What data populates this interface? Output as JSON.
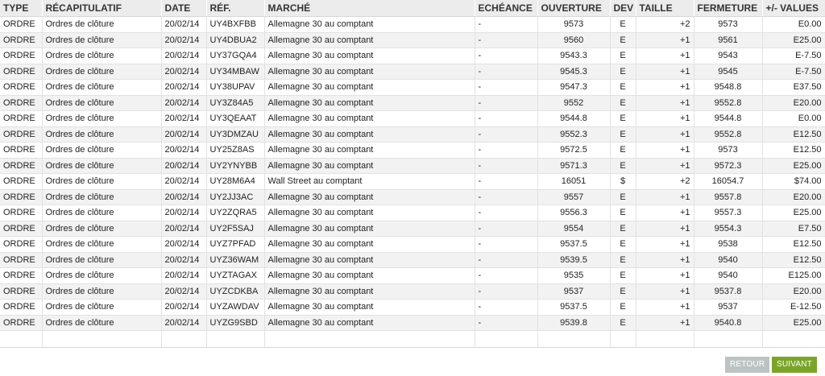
{
  "columns": {
    "type": "TYPE",
    "recap": "RÉCAPITULATIF",
    "date": "DATE",
    "ref": "RÉF.",
    "marche": "MARCHÉ",
    "echeance": "ECHÉANCE",
    "ouverture": "OUVERTURE",
    "dev": "DEV",
    "taille": "TAILLE",
    "fermeture": "FERMETURE",
    "values": "+/- VALUES"
  },
  "rows": [
    {
      "type": "ORDRE",
      "recap": "Ordres de clôture",
      "date": "20/02/14",
      "ref": "UY4BXFBB",
      "marche": "Allemagne 30 au comptant",
      "echeance": "-",
      "ouverture": "9573",
      "dev": "E",
      "taille": "+2",
      "fermeture": "9573",
      "values": "E0.00"
    },
    {
      "type": "ORDRE",
      "recap": "Ordres de clôture",
      "date": "20/02/14",
      "ref": "UY4DBUA2",
      "marche": "Allemagne 30 au comptant",
      "echeance": "-",
      "ouverture": "9560",
      "dev": "E",
      "taille": "+1",
      "fermeture": "9561",
      "values": "E25.00"
    },
    {
      "type": "ORDRE",
      "recap": "Ordres de clôture",
      "date": "20/02/14",
      "ref": "UY37GQA4",
      "marche": "Allemagne 30 au comptant",
      "echeance": "-",
      "ouverture": "9543.3",
      "dev": "E",
      "taille": "+1",
      "fermeture": "9543",
      "values": "E-7.50"
    },
    {
      "type": "ORDRE",
      "recap": "Ordres de clôture",
      "date": "20/02/14",
      "ref": "UY34MBAW",
      "marche": "Allemagne 30 au comptant",
      "echeance": "-",
      "ouverture": "9545.3",
      "dev": "E",
      "taille": "+1",
      "fermeture": "9545",
      "values": "E-7.50"
    },
    {
      "type": "ORDRE",
      "recap": "Ordres de clôture",
      "date": "20/02/14",
      "ref": "UY38UPAV",
      "marche": "Allemagne 30 au comptant",
      "echeance": "-",
      "ouverture": "9547.3",
      "dev": "E",
      "taille": "+1",
      "fermeture": "9548.8",
      "values": "E37.50"
    },
    {
      "type": "ORDRE",
      "recap": "Ordres de clôture",
      "date": "20/02/14",
      "ref": "UY3Z84A5",
      "marche": "Allemagne 30 au comptant",
      "echeance": "-",
      "ouverture": "9552",
      "dev": "E",
      "taille": "+1",
      "fermeture": "9552.8",
      "values": "E20.00"
    },
    {
      "type": "ORDRE",
      "recap": "Ordres de clôture",
      "date": "20/02/14",
      "ref": "UY3QEAAT",
      "marche": "Allemagne 30 au comptant",
      "echeance": "-",
      "ouverture": "9544.8",
      "dev": "E",
      "taille": "+1",
      "fermeture": "9544.8",
      "values": "E0.00"
    },
    {
      "type": "ORDRE",
      "recap": "Ordres de clôture",
      "date": "20/02/14",
      "ref": "UY3DMZAU",
      "marche": "Allemagne 30 au comptant",
      "echeance": "-",
      "ouverture": "9552.3",
      "dev": "E",
      "taille": "+1",
      "fermeture": "9552.8",
      "values": "E12.50"
    },
    {
      "type": "ORDRE",
      "recap": "Ordres de clôture",
      "date": "20/02/14",
      "ref": "UY25Z8AS",
      "marche": "Allemagne 30 au comptant",
      "echeance": "-",
      "ouverture": "9572.5",
      "dev": "E",
      "taille": "+1",
      "fermeture": "9573",
      "values": "E12.50"
    },
    {
      "type": "ORDRE",
      "recap": "Ordres de clôture",
      "date": "20/02/14",
      "ref": "UY2YNYBB",
      "marche": "Allemagne 30 au comptant",
      "echeance": "-",
      "ouverture": "9571.3",
      "dev": "E",
      "taille": "+1",
      "fermeture": "9572.3",
      "values": "E25.00"
    },
    {
      "type": "ORDRE",
      "recap": "Ordres de clôture",
      "date": "20/02/14",
      "ref": "UY28M6A4",
      "marche": "Wall Street au comptant",
      "echeance": "-",
      "ouverture": "16051",
      "dev": "$",
      "taille": "+2",
      "fermeture": "16054.7",
      "values": "$74.00"
    },
    {
      "type": "ORDRE",
      "recap": "Ordres de clôture",
      "date": "20/02/14",
      "ref": "UY2JJ3AC",
      "marche": "Allemagne 30 au comptant",
      "echeance": "-",
      "ouverture": "9557",
      "dev": "E",
      "taille": "+1",
      "fermeture": "9557.8",
      "values": "E20.00"
    },
    {
      "type": "ORDRE",
      "recap": "Ordres de clôture",
      "date": "20/02/14",
      "ref": "UY2ZQRA5",
      "marche": "Allemagne 30 au comptant",
      "echeance": "-",
      "ouverture": "9556.3",
      "dev": "E",
      "taille": "+1",
      "fermeture": "9557.3",
      "values": "E25.00"
    },
    {
      "type": "ORDRE",
      "recap": "Ordres de clôture",
      "date": "20/02/14",
      "ref": "UY2F5SAJ",
      "marche": "Allemagne 30 au comptant",
      "echeance": "-",
      "ouverture": "9554",
      "dev": "E",
      "taille": "+1",
      "fermeture": "9554.3",
      "values": "E7.50"
    },
    {
      "type": "ORDRE",
      "recap": "Ordres de clôture",
      "date": "20/02/14",
      "ref": "UYZ7PFAD",
      "marche": "Allemagne 30 au comptant",
      "echeance": "-",
      "ouverture": "9537.5",
      "dev": "E",
      "taille": "+1",
      "fermeture": "9538",
      "values": "E12.50"
    },
    {
      "type": "ORDRE",
      "recap": "Ordres de clôture",
      "date": "20/02/14",
      "ref": "UYZ36WAM",
      "marche": "Allemagne 30 au comptant",
      "echeance": "-",
      "ouverture": "9539.5",
      "dev": "E",
      "taille": "+1",
      "fermeture": "9540",
      "values": "E12.50"
    },
    {
      "type": "ORDRE",
      "recap": "Ordres de clôture",
      "date": "20/02/14",
      "ref": "UYZTAGAX",
      "marche": "Allemagne 30 au comptant",
      "echeance": "-",
      "ouverture": "9535",
      "dev": "E",
      "taille": "+1",
      "fermeture": "9540",
      "values": "E125.00"
    },
    {
      "type": "ORDRE",
      "recap": "Ordres de clôture",
      "date": "20/02/14",
      "ref": "UYZCDKBA",
      "marche": "Allemagne 30 au comptant",
      "echeance": "-",
      "ouverture": "9537",
      "dev": "E",
      "taille": "+1",
      "fermeture": "9537.8",
      "values": "E20.00"
    },
    {
      "type": "ORDRE",
      "recap": "Ordres de clôture",
      "date": "20/02/14",
      "ref": "UYZAWDAV",
      "marche": "Allemagne 30 au comptant",
      "echeance": "-",
      "ouverture": "9537.5",
      "dev": "E",
      "taille": "+1",
      "fermeture": "9537",
      "values": "E-12.50"
    },
    {
      "type": "ORDRE",
      "recap": "Ordres de clôture",
      "date": "20/02/14",
      "ref": "UYZG9SBD",
      "marche": "Allemagne 30 au comptant",
      "echeance": "-",
      "ouverture": "9539.8",
      "dev": "E",
      "taille": "+1",
      "fermeture": "9540.8",
      "values": "E25.00"
    }
  ],
  "buttons": {
    "retour": "RETOUR",
    "suivant": "SUIVANT"
  },
  "colors": {
    "retour_bg": "#bcc3c3",
    "suivant_bg": "#7aa52a"
  }
}
